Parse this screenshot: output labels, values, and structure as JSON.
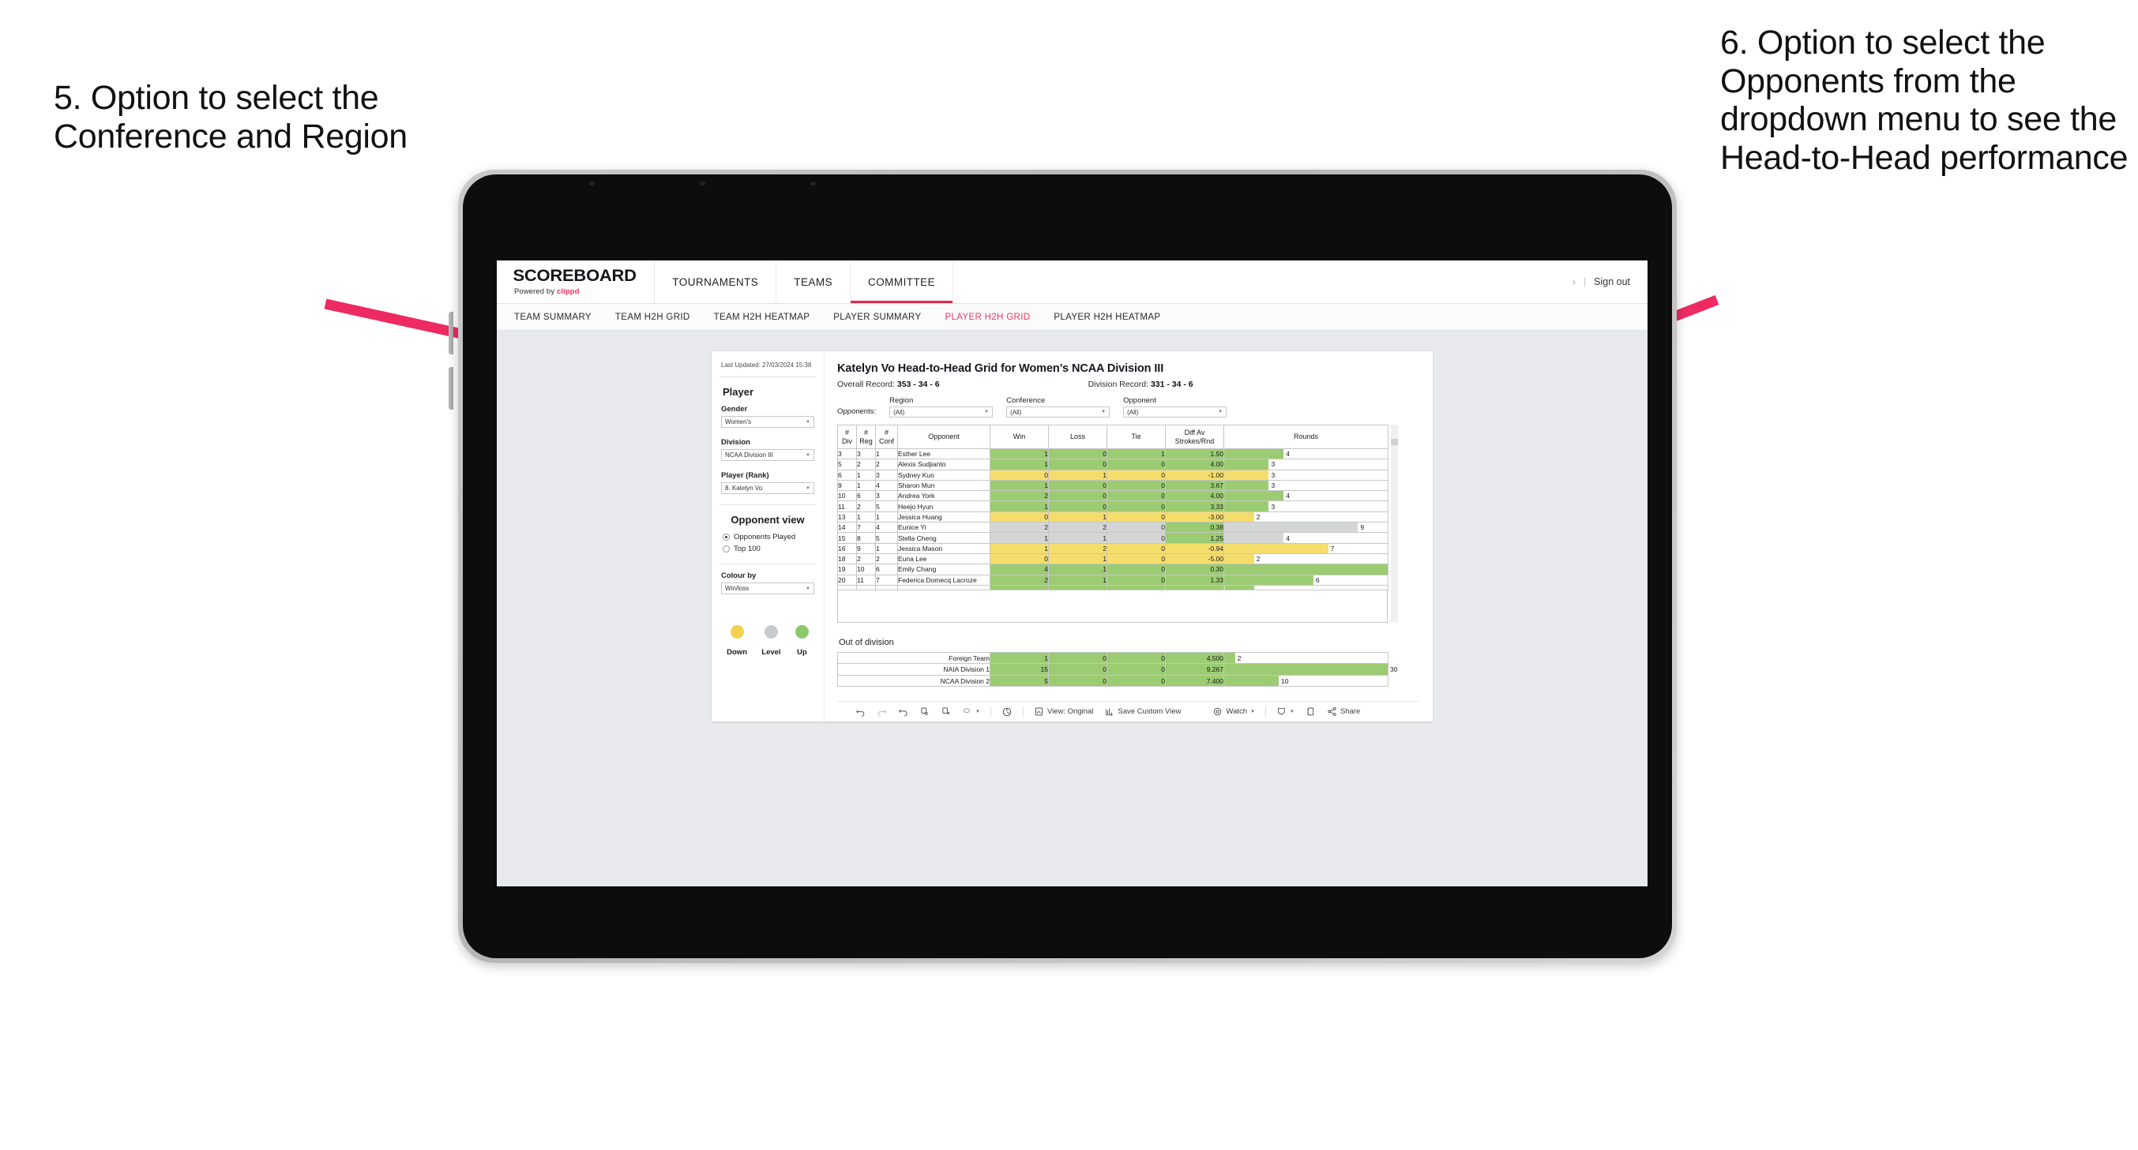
{
  "annotations": {
    "left": "5. Option to select the Conference and Region",
    "right": "6. Option to select the Opponents from the dropdown menu to see the Head-to-Head performance",
    "arrow_color": "#ed2a62"
  },
  "appbar": {
    "brand_title": "SCOREBOARD",
    "brand_sub_prefix": "Powered by ",
    "brand_sub_accent": "clippd",
    "nav": [
      {
        "label": "TOURNAMENTS",
        "active": false
      },
      {
        "label": "TEAMS",
        "active": false
      },
      {
        "label": "COMMITTEE",
        "active": true
      }
    ],
    "chevron": "›",
    "separator": "|",
    "sign_out": "Sign out"
  },
  "subnav": {
    "items": [
      {
        "label": "TEAM SUMMARY",
        "active": false
      },
      {
        "label": "TEAM H2H GRID",
        "active": false
      },
      {
        "label": "TEAM H2H HEATMAP",
        "active": false
      },
      {
        "label": "PLAYER SUMMARY",
        "active": false
      },
      {
        "label": "PLAYER H2H GRID",
        "active": true
      },
      {
        "label": "PLAYER H2H HEATMAP",
        "active": false
      }
    ],
    "active_color": "#ef3a62"
  },
  "sidebar": {
    "last_updated": "Last Updated: 27/03/2024 15:38",
    "player_heading": "Player",
    "fields": [
      {
        "label": "Gender",
        "value": "Women’s"
      },
      {
        "label": "Division",
        "value": "NCAA Division III"
      },
      {
        "label": "Player (Rank)",
        "value": "8. Katelyn Vo"
      }
    ],
    "opponent_view_heading": "Opponent view",
    "opponent_view_options": [
      {
        "label": "Opponents Played",
        "selected": true
      },
      {
        "label": "Top 100",
        "selected": false
      }
    ],
    "colour_by_label": "Colour by",
    "colour_by_value": "Win/loss",
    "legend": [
      {
        "label": "Down",
        "color": "#f2d24b"
      },
      {
        "label": "Level",
        "color": "#c7cbce"
      },
      {
        "label": "Up",
        "color": "#8dc96a"
      }
    ]
  },
  "main": {
    "title": "Katelyn Vo Head-to-Head Grid for Women’s NCAA Division III",
    "overall_label": "Overall Record: ",
    "overall_value": "353 - 34 - 6",
    "division_label": "Division Record: ",
    "division_value": "331 - 34 - 6",
    "opponents_label": "Opponents:",
    "filters": [
      {
        "label": "Region",
        "value": "(All)"
      },
      {
        "label": "Conference",
        "value": "(All)"
      },
      {
        "label": "Opponent",
        "value": "(All)"
      }
    ]
  },
  "chart_data": {
    "type": "table",
    "title": "Katelyn Vo Head-to-Head Grid for Women’s NCAA Division III",
    "columns": [
      "# Div",
      "# Reg",
      "# Conf",
      "Opponent",
      "Win",
      "Loss",
      "Tie",
      "Diff Av Strokes/Rnd",
      "Rounds"
    ],
    "column_headers_multiline": [
      [
        "#",
        "Div"
      ],
      [
        "#",
        "Reg"
      ],
      [
        "#",
        "Conf"
      ],
      [
        "Opponent"
      ],
      [
        "Win"
      ],
      [
        "Loss"
      ],
      [
        "Tie"
      ],
      [
        "Diff Av",
        "Strokes/Rnd"
      ],
      [
        "Rounds"
      ]
    ],
    "rounds_max": 11,
    "colors": {
      "up": "#9ccc72",
      "down": "#f5dd6b",
      "level": "#d4d6d5",
      "white": "#ffffff"
    },
    "rows": [
      {
        "div": "3",
        "reg": "3",
        "conf": "1",
        "opponent": "Esther Lee",
        "win": "1",
        "loss": "0",
        "tie": "1",
        "diff": "1.50",
        "rounds": "4",
        "state": "up"
      },
      {
        "div": "5",
        "reg": "2",
        "conf": "2",
        "opponent": "Alexis Sudjianto",
        "win": "1",
        "loss": "0",
        "tie": "0",
        "diff": "4.00",
        "rounds": "3",
        "state": "up"
      },
      {
        "div": "6",
        "reg": "1",
        "conf": "3",
        "opponent": "Sydney Kuo",
        "win": "0",
        "loss": "1",
        "tie": "0",
        "diff": "-1.00",
        "rounds": "3",
        "state": "down"
      },
      {
        "div": "9",
        "reg": "1",
        "conf": "4",
        "opponent": "Sharon Mun",
        "win": "1",
        "loss": "0",
        "tie": "0",
        "diff": "3.67",
        "rounds": "3",
        "state": "up"
      },
      {
        "div": "10",
        "reg": "6",
        "conf": "3",
        "opponent": "Andrea York",
        "win": "2",
        "loss": "0",
        "tie": "0",
        "diff": "4.00",
        "rounds": "4",
        "state": "up"
      },
      {
        "div": "11",
        "reg": "2",
        "conf": "5",
        "opponent": "Heejo Hyun",
        "win": "1",
        "loss": "0",
        "tie": "0",
        "diff": "3.33",
        "rounds": "3",
        "state": "up"
      },
      {
        "div": "13",
        "reg": "1",
        "conf": "1",
        "opponent": "Jessica Huang",
        "win": "0",
        "loss": "1",
        "tie": "0",
        "diff": "-3.00",
        "rounds": "2",
        "state": "down"
      },
      {
        "div": "14",
        "reg": "7",
        "conf": "4",
        "opponent": "Eunice Yi",
        "win": "2",
        "loss": "2",
        "tie": "0",
        "diff": "0.38",
        "rounds": "9",
        "state": "level",
        "diff_state": "up"
      },
      {
        "div": "15",
        "reg": "8",
        "conf": "5",
        "opponent": "Stella Cheng",
        "win": "1",
        "loss": "1",
        "tie": "0",
        "diff": "1.25",
        "rounds": "4",
        "state": "level",
        "diff_state": "up"
      },
      {
        "div": "16",
        "reg": "9",
        "conf": "1",
        "opponent": "Jessica Mason",
        "win": "1",
        "loss": "2",
        "tie": "0",
        "diff": "-0.94",
        "rounds": "7",
        "state": "down"
      },
      {
        "div": "18",
        "reg": "2",
        "conf": "2",
        "opponent": "Euna Lee",
        "win": "0",
        "loss": "1",
        "tie": "0",
        "diff": "-5.00",
        "rounds": "2",
        "state": "down"
      },
      {
        "div": "19",
        "reg": "10",
        "conf": "6",
        "opponent": "Emily Chang",
        "win": "4",
        "loss": "1",
        "tie": "0",
        "diff": "0.30",
        "rounds": "11",
        "state": "up"
      },
      {
        "div": "20",
        "reg": "11",
        "conf": "7",
        "opponent": "Federica Domecq Lacroze",
        "win": "2",
        "loss": "1",
        "tie": "0",
        "diff": "1.33",
        "rounds": "6",
        "state": "up"
      }
    ],
    "out_of_division_title": "Out of division",
    "out_of_division": [
      {
        "name": "Foreign Team",
        "win": "1",
        "loss": "0",
        "tie": "0",
        "diff": "4.500",
        "rounds": "2",
        "state": "up"
      },
      {
        "name": "NAIA Division 1",
        "win": "15",
        "loss": "0",
        "tie": "0",
        "diff": "9.267",
        "rounds": "30",
        "state": "up"
      },
      {
        "name": "NCAA Division 2",
        "win": "5",
        "loss": "0",
        "tie": "0",
        "diff": "7.400",
        "rounds": "10",
        "state": "up"
      }
    ],
    "out_of_division_rounds_max": 30
  },
  "toolbar": {
    "view_label": "View: Original",
    "save_label": "Save Custom View",
    "watch_label": "Watch",
    "share_label": "Share",
    "caret": "▾"
  }
}
